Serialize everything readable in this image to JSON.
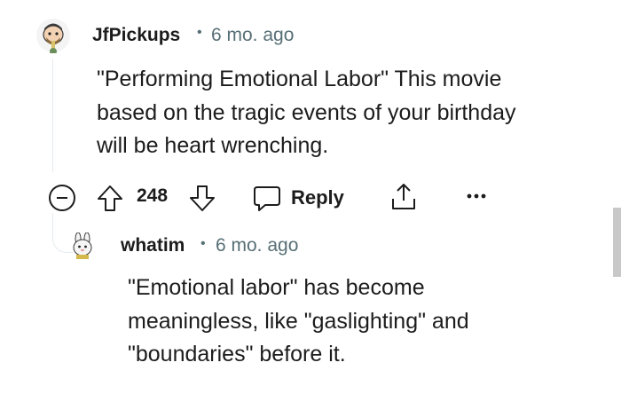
{
  "comments": [
    {
      "username": "JfPickups",
      "separator": "•",
      "time": "6 mo. ago",
      "lines": [
        "\"Performing Emotional Labor\" This movie",
        "based on the tragic events of your birthday",
        "will be heart wrenching."
      ],
      "avatar_icon": "avatar-bearded-snoo-icon"
    },
    {
      "username": "whatim",
      "separator": "•",
      "time": "6 mo. ago",
      "lines": [
        "\"Emotional labor\" has become",
        "meaningless, like \"gaslighting\" and",
        "\"boundaries\" before it."
      ],
      "avatar_icon": "avatar-bunny-snoo-icon"
    }
  ],
  "actions": {
    "vote_count": "248",
    "reply_label": "Reply",
    "icons": [
      "collapse-icon",
      "upvote-icon",
      "downvote-icon",
      "reply-icon",
      "share-icon",
      "more-icon"
    ]
  },
  "colors": {
    "text": "#1c1c1c",
    "meta": "#576f76",
    "thread_line": "#e5ebee",
    "scrollbar": "#c8c8c8"
  }
}
